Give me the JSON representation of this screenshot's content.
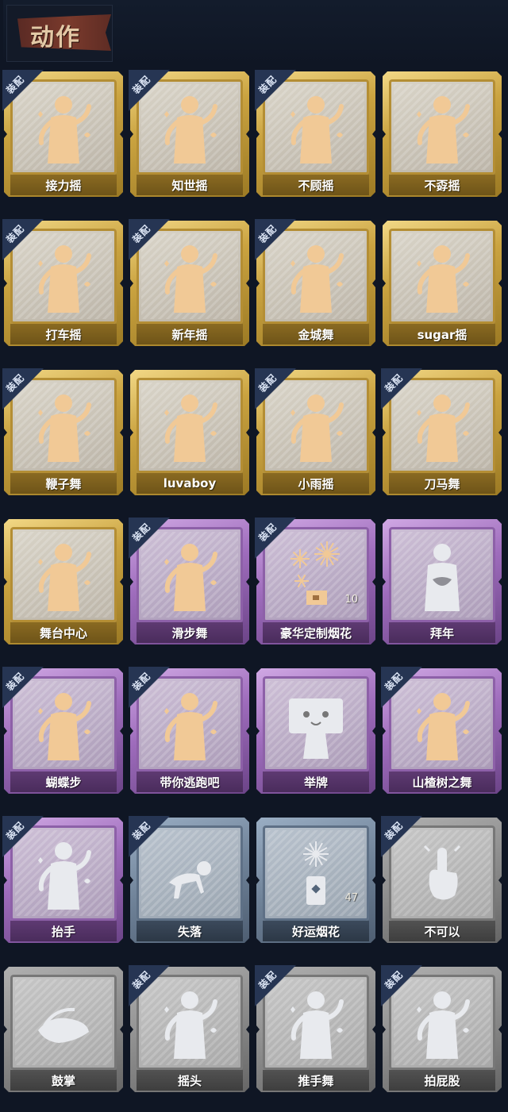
{
  "header": {
    "title": "动作"
  },
  "equip_label": "装配",
  "colors": {
    "gold": "#caa340",
    "purple": "#9e6cbc",
    "blue": "#6f8298",
    "gray": "#8c8c8c",
    "figure_gold": "#f1c996",
    "figure_silver": "#e8eaee"
  },
  "actions": [
    {
      "name": "接力摇",
      "tier": "gold",
      "equipped": true,
      "icon": "dancer-icon"
    },
    {
      "name": "知世摇",
      "tier": "gold",
      "equipped": true,
      "icon": "dancer-icon"
    },
    {
      "name": "不顾摇",
      "tier": "gold",
      "equipped": true,
      "icon": "dancer-icon"
    },
    {
      "name": "不孬摇",
      "tier": "gold",
      "equipped": false,
      "icon": "dancer-icon"
    },
    {
      "name": "打车摇",
      "tier": "gold",
      "equipped": true,
      "icon": "dancer-icon"
    },
    {
      "name": "新年摇",
      "tier": "gold",
      "equipped": true,
      "icon": "dancer-icon"
    },
    {
      "name": "金城舞",
      "tier": "gold",
      "equipped": true,
      "icon": "dancer-icon"
    },
    {
      "name": "sugar摇",
      "tier": "gold",
      "equipped": false,
      "icon": "dancer-icon"
    },
    {
      "name": "鞭子舞",
      "tier": "gold",
      "equipped": true,
      "icon": "dancer-icon"
    },
    {
      "name": "luvaboy",
      "tier": "gold",
      "equipped": false,
      "icon": "dancer-icon"
    },
    {
      "name": "小雨摇",
      "tier": "gold",
      "equipped": true,
      "icon": "dancer-icon"
    },
    {
      "name": "刀马舞",
      "tier": "gold",
      "equipped": true,
      "icon": "dancer-icon"
    },
    {
      "name": "舞台中心",
      "tier": "gold",
      "equipped": false,
      "icon": "dancer-icon"
    },
    {
      "name": "滑步舞",
      "tier": "purple",
      "equipped": true,
      "icon": "dancer-icon"
    },
    {
      "name": "豪华定制烟花",
      "tier": "purple",
      "equipped": true,
      "icon": "fireworks-icon",
      "count": "10"
    },
    {
      "name": "拜年",
      "tier": "purple",
      "equipped": false,
      "icon": "bow-icon"
    },
    {
      "name": "蝴蝶步",
      "tier": "purple",
      "equipped": true,
      "icon": "dancer-icon"
    },
    {
      "name": "带你逃跑吧",
      "tier": "purple",
      "equipped": true,
      "icon": "dancer-icon"
    },
    {
      "name": "举牌",
      "tier": "purple",
      "equipped": false,
      "icon": "sign-icon"
    },
    {
      "name": "山楂树之舞",
      "tier": "purple",
      "equipped": true,
      "icon": "dancer-icon"
    },
    {
      "name": "抬手",
      "tier": "purple",
      "equipped": true,
      "icon": "dancer-icon"
    },
    {
      "name": "失落",
      "tier": "blue",
      "equipped": true,
      "icon": "crawl-icon"
    },
    {
      "name": "好运烟花",
      "tier": "blue",
      "equipped": false,
      "icon": "firecracker-icon",
      "count": "47"
    },
    {
      "name": "不可以",
      "tier": "gray",
      "equipped": true,
      "icon": "finger-icon"
    },
    {
      "name": "鼓掌",
      "tier": "gray",
      "equipped": false,
      "icon": "clap-icon"
    },
    {
      "name": "摇头",
      "tier": "gray",
      "equipped": true,
      "icon": "dancer-icon"
    },
    {
      "name": "推手舞",
      "tier": "gray",
      "equipped": true,
      "icon": "dancer-icon"
    },
    {
      "name": "拍屁股",
      "tier": "gray",
      "equipped": true,
      "icon": "dancer-icon"
    }
  ]
}
